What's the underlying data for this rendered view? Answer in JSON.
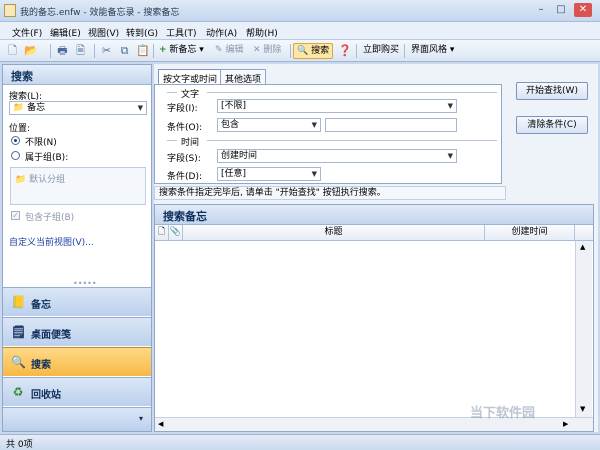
{
  "window": {
    "title": "我的备忘.enfw - 效能备忘录 - 搜索备忘",
    "controls": [
      "–",
      "□",
      "✕"
    ]
  },
  "menu": [
    "文件(F)",
    "编辑(E)",
    "视图(V)",
    "转到(G)",
    "工具(T)",
    "动作(A)",
    "帮助(H)"
  ],
  "toolbar": {
    "new_note": "新备忘",
    "edit": "编辑",
    "delete": "删除",
    "search": "搜索",
    "buy": "立即购买",
    "theme": "界面风格"
  },
  "left": {
    "header": "搜索",
    "search_label": "搜索(L):",
    "search_target": "备忘",
    "position_label": "位置:",
    "pos_unlimited": "不限(N)",
    "pos_group": "属于组(B):",
    "default_group": "默认分组",
    "include_subgroups": "包含子组(B)",
    "custom_view": "自定义当前视图(V)...",
    "nav": [
      {
        "label": "备忘",
        "icon": "📒"
      },
      {
        "label": "桌面便笺",
        "icon": "🗒"
      },
      {
        "label": "搜索",
        "icon": "🔍"
      },
      {
        "label": "回收站",
        "icon": "♻"
      }
    ]
  },
  "search": {
    "tabs": [
      "按文字或时间",
      "其他选项"
    ],
    "text_section": "文字",
    "time_section": "时间",
    "field_label": "字段(I):",
    "field_value": "[不限]",
    "cond_label": "条件(O):",
    "cond_value": "包含",
    "cond_text": "",
    "time_field_label": "字段(S):",
    "time_field_value": "创建时间",
    "time_cond_label": "条件(D):",
    "time_cond_value": "[任意]",
    "start_btn": "开始查找(W)",
    "clear_btn": "清除条件(C)",
    "hint": "搜索条件指定完毕后, 请单击 \"开始查找\" 按钮执行搜索。"
  },
  "results": {
    "header": "搜索备忘",
    "columns": [
      "标题",
      "创建时间"
    ]
  },
  "status": "共 0项",
  "watermark": "当下软件园"
}
